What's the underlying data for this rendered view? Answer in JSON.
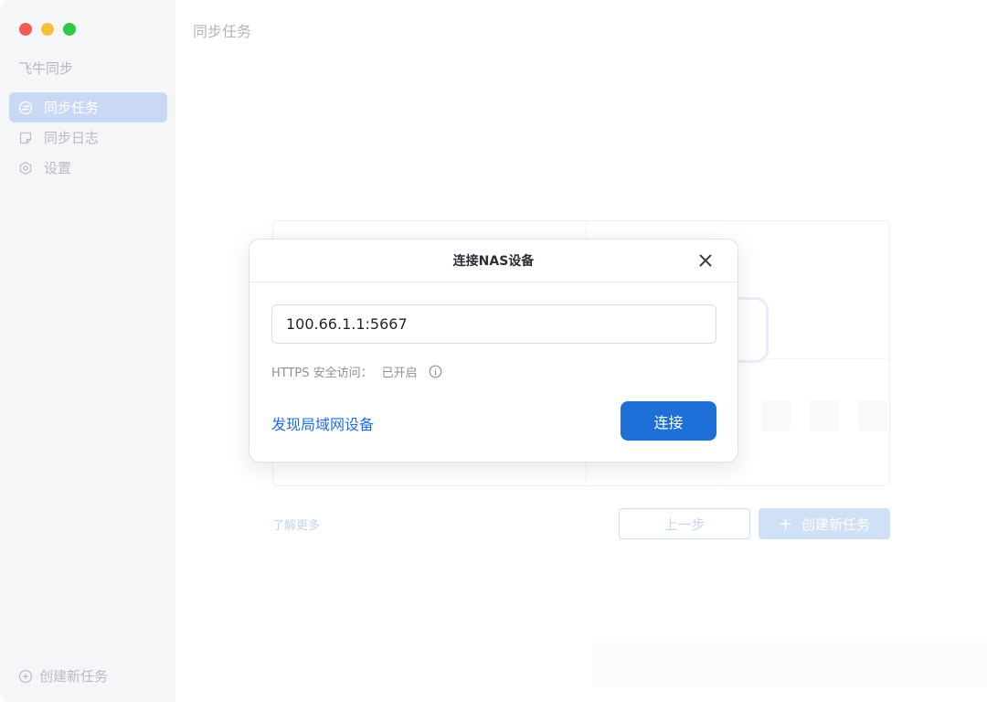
{
  "sidebar": {
    "app_name": "飞牛同步",
    "items": [
      {
        "label": "同步任务",
        "icon": "sync-icon",
        "active": true
      },
      {
        "label": "同步日志",
        "icon": "note-icon",
        "active": false
      },
      {
        "label": "设置",
        "icon": "gear-icon",
        "active": false
      }
    ],
    "create_label": "创建新任务"
  },
  "main": {
    "title": "同步任务",
    "learn_more": "了解更多",
    "prev_label": "上一步",
    "create_task_label": "创建新任务",
    "create_task_icon": "plus-icon"
  },
  "modal": {
    "title": "连接NAS设备",
    "close_icon": "close-icon",
    "address_value": "100.66.1.1:5667",
    "https_label": "HTTPS 安全访问：",
    "https_status": "已开启",
    "info_icon": "info-icon",
    "discover_link": "发现局域网设备",
    "connect_label": "连接"
  },
  "colors": {
    "accent": "#1f6fd8",
    "sidebar_bg": "#f5f6f8",
    "active_item_bg": "#c9d9f3",
    "traffic_red": "#f25c55",
    "traffic_yellow": "#f5bf3b",
    "traffic_green": "#31c844"
  }
}
